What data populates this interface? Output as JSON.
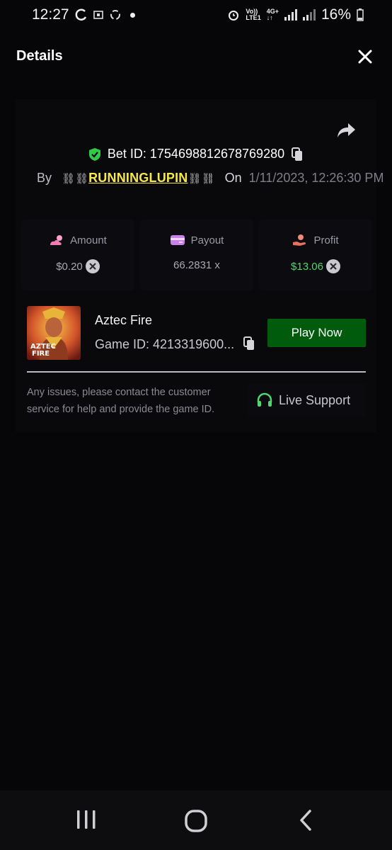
{
  "status_bar": {
    "time": "12:27",
    "battery": "16%",
    "volte_top": "Vo))",
    "volte_bottom": "LTE1",
    "network": "4G+"
  },
  "header": {
    "title": "Details"
  },
  "bet": {
    "label": "Bet ID: 1754698812678769280",
    "by_label": "By",
    "chain_left": "⛓⛓",
    "username": "RUNNINGLUPIN",
    "chain_right": "⛓⛓",
    "on_label": "On",
    "date": "1/11/2023, 12:26:30 PM"
  },
  "stats": {
    "amount_label": "Amount",
    "amount_value": "$0.20",
    "payout_label": "Payout",
    "payout_value": "66.2831 x",
    "profit_label": "Profit",
    "profit_value": "$13.06"
  },
  "game": {
    "name": "Aztec Fire",
    "id_text": "Game ID: 4213319600...",
    "thumb_title_1": "AZTEC",
    "thumb_title_2": "FIRE",
    "play_label": "Play Now"
  },
  "support": {
    "help_text": "Any issues, please contact the customer service for help and provide the game ID.",
    "button_label": "Live Support"
  },
  "colors": {
    "background": "#060608",
    "username": "#f6e84b",
    "profit": "#4fd66d",
    "play_button": "#005c0c",
    "shield": "#32c84a",
    "headset": "#4fd66d"
  },
  "icons": {
    "share": "share-icon",
    "close": "close-icon",
    "shield": "shield-check-icon",
    "copy": "copy-icon",
    "amount": "cloud-sun-icon",
    "payout": "credit-card-icon",
    "profit": "hand-user-icon",
    "coin": "coin-icon",
    "support": "headset-icon"
  }
}
